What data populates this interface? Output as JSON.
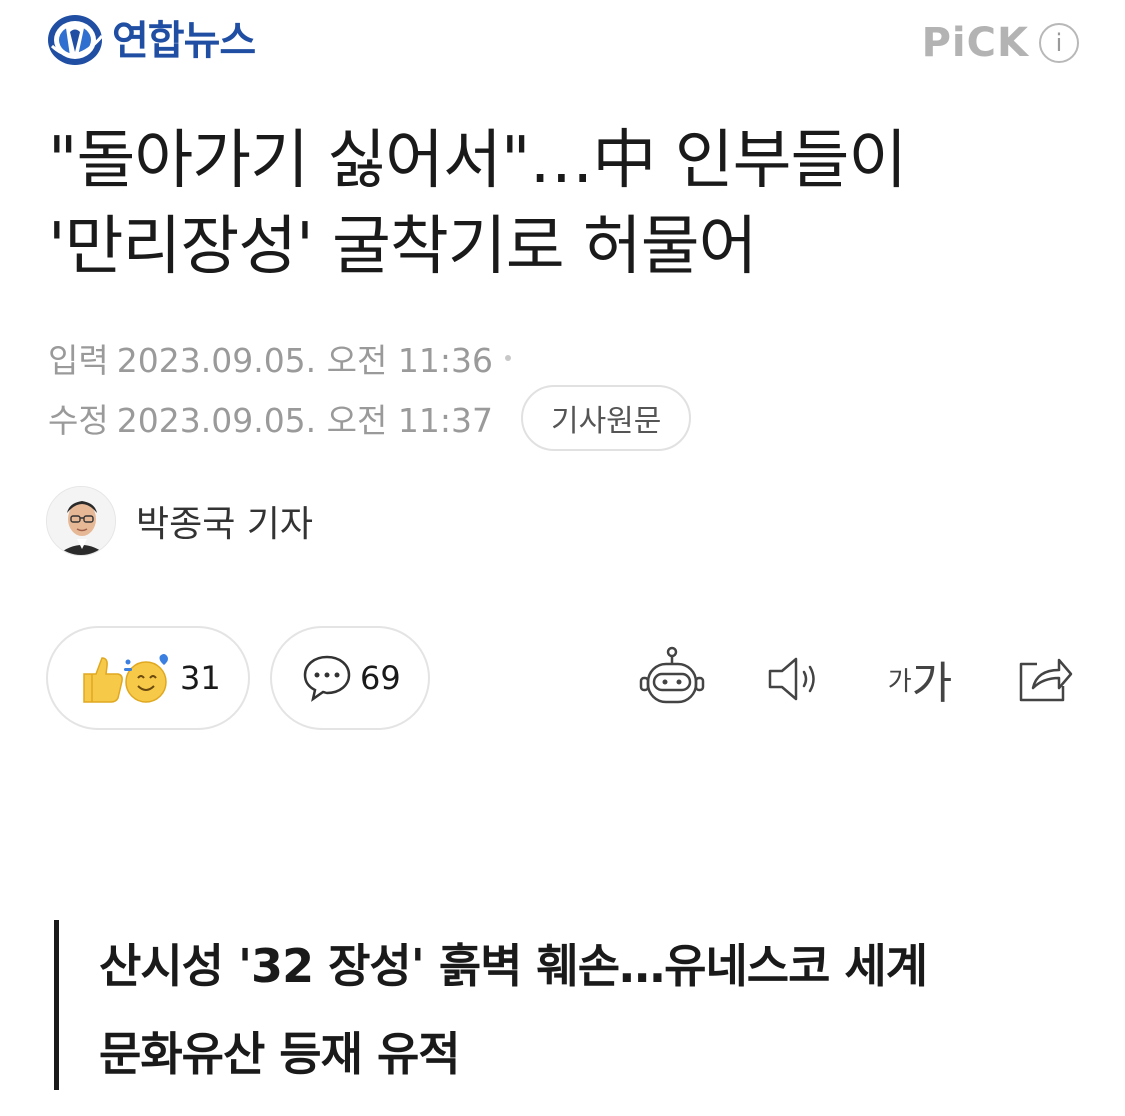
{
  "header": {
    "brand": "연합뉴스",
    "pick_label": "PiCK",
    "info_label": "i"
  },
  "article": {
    "title_line1": "\"돌아가기 싫어서\"…中 인부들이",
    "title_line2": "'만리장성' 굴착기로 허물어",
    "input_label": "입력",
    "input_datetime": "2023.09.05. 오전 11:36",
    "modified_label": "수정",
    "modified_datetime": "2023.09.05. 오전 11:37",
    "original_button": "기사원문",
    "reporter": "박종국 기자"
  },
  "actions": {
    "reaction_count": "31",
    "comment_count": "69",
    "font_small": "가",
    "font_large": "가"
  },
  "subheading": {
    "line1": "산시성 '32 장성' 흙벽 훼손…유네스코 세계",
    "line2": "문화유산 등재 유적"
  },
  "colors": {
    "brand_blue": "#1f4ea3",
    "pick_gray": "#b3b3b3",
    "meta_gray": "#9a9a9a"
  },
  "icons": [
    "yonhap-logo-icon",
    "info-icon",
    "thumbs-up-icon",
    "smile-icon",
    "comment-icon",
    "ai-bot-icon",
    "speaker-icon",
    "font-size-icon",
    "share-icon"
  ]
}
